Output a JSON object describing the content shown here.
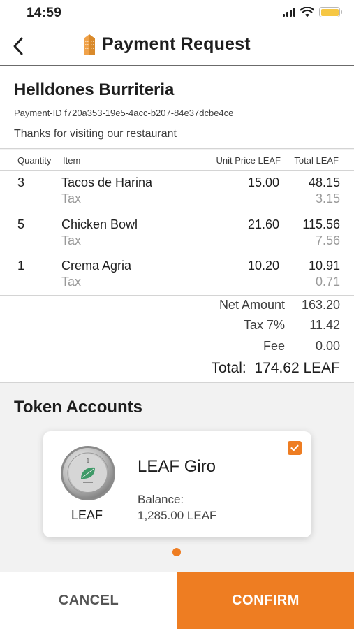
{
  "status_bar": {
    "time": "14:59",
    "icons": [
      "signal-icon",
      "wifi-icon",
      "battery-icon"
    ],
    "battery_color": "#f6c744"
  },
  "header": {
    "title": "Payment Request",
    "back_icon": "chevron-left-icon",
    "logo_icon": "building-logo-icon"
  },
  "merchant": {
    "name": "Helldones Burriteria",
    "payment_id": "Payment-ID f720a353-19e5-4acc-b207-84e37dcbe4ce",
    "message": "Thanks for visiting our restaurant"
  },
  "table": {
    "headers": {
      "quantity": "Quantity",
      "item": "Item",
      "unit_price": "Unit Price LEAF",
      "total": "Total LEAF"
    },
    "rows": [
      {
        "quantity": "3",
        "item": "Tacos de Harina",
        "unit_price": "15.00",
        "total": "48.15",
        "tax_label": "Tax",
        "tax": "3.15"
      },
      {
        "quantity": "5",
        "item": "Chicken Bowl",
        "unit_price": "21.60",
        "total": "115.56",
        "tax_label": "Tax",
        "tax": "7.56"
      },
      {
        "quantity": "1",
        "item": "Crema Agria",
        "unit_price": "10.20",
        "total": "10.91",
        "tax_label": "Tax",
        "tax": "0.71"
      }
    ]
  },
  "summary": {
    "net_label": "Net Amount",
    "net_value": "163.20",
    "tax_label": "Tax 7%",
    "tax_value": "11.42",
    "fee_label": "Fee",
    "fee_value": "0.00",
    "total_text": "Total:  174.62 LEAF"
  },
  "token_accounts": {
    "title": "Token Accounts",
    "accounts": [
      {
        "token_label": "LEAF",
        "name": "LEAF Giro",
        "balance_label": "Balance:",
        "balance": "1,285.00 LEAF",
        "selected": true,
        "coin_icon": "leaf-coin-icon"
      }
    ],
    "page_indicator_active": 1
  },
  "footer": {
    "cancel_label": "CANCEL",
    "confirm_label": "CONFIRM"
  },
  "colors": {
    "accent": "#ee7d22",
    "background": "#f2f2f2",
    "tax_text": "#9a9a9a"
  }
}
